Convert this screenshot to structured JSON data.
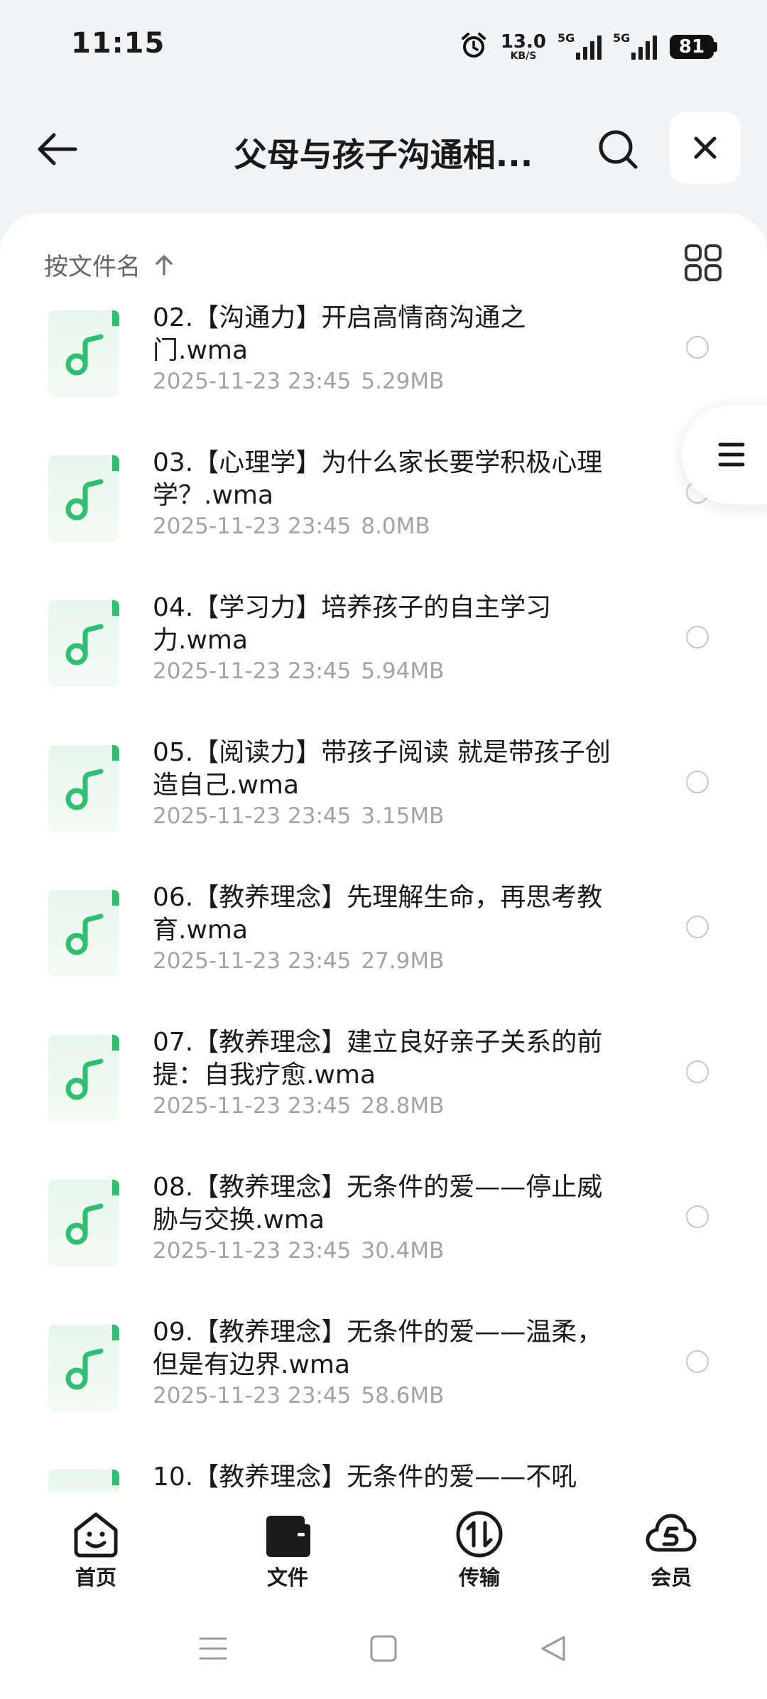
{
  "status_bar": {
    "time": "11:15",
    "net_speed": "13.0",
    "net_unit": "KB/S",
    "signal_label": "5G",
    "battery": "81"
  },
  "header": {
    "title": "父母与孩子沟通相..."
  },
  "sort": {
    "label": "按文件名"
  },
  "files": [
    {
      "name": "02.【沟通力】开启高情商沟通之门.wma",
      "date": "2025-11-23 23:45",
      "size": "5.29MB"
    },
    {
      "name": "03.【心理学】为什么家长要学积极心理学？.wma",
      "date": "2025-11-23 23:45",
      "size": "8.0MB"
    },
    {
      "name": "04.【学习力】培养孩子的自主学习力.wma",
      "date": "2025-11-23 23:45",
      "size": "5.94MB"
    },
    {
      "name": "05.【阅读力】带孩子阅读 就是带孩子创造自己.wma",
      "date": "2025-11-23 23:45",
      "size": "3.15MB"
    },
    {
      "name": "06.【教养理念】先理解生命，再思考教育.wma",
      "date": "2025-11-23 23:45",
      "size": "27.9MB"
    },
    {
      "name": "07.【教养理念】建立良好亲子关系的前提：自我疗愈.wma",
      "date": "2025-11-23 23:45",
      "size": "28.8MB"
    },
    {
      "name": "08.【教养理念】无条件的爱——停止威胁与交换.wma",
      "date": "2025-11-23 23:45",
      "size": "30.4MB"
    },
    {
      "name": "09.【教养理念】无条件的爱——温柔，但是有边界.wma",
      "date": "2025-11-23 23:45",
      "size": "58.6MB"
    },
    {
      "name": "10.【教养理念】无条件的爱——不吼",
      "date": "",
      "size": ""
    }
  ],
  "nav": [
    {
      "label": "首页",
      "icon": "smile-face-icon"
    },
    {
      "label": "文件",
      "icon": "folder-icon"
    },
    {
      "label": "传输",
      "icon": "transfer-icon"
    },
    {
      "label": "会员",
      "icon": "vip-cloud-icon"
    }
  ],
  "colors": {
    "accent": "#2fbf71",
    "text": "#1a1a1a",
    "muted": "#a3a3a3"
  }
}
